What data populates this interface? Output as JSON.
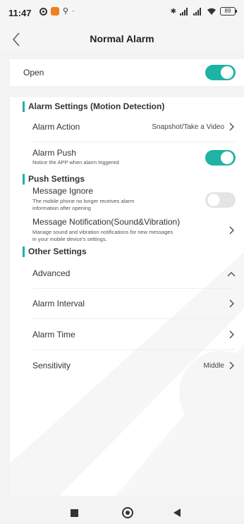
{
  "status_bar": {
    "time": "11:47",
    "battery": "89"
  },
  "header": {
    "title": "Normal Alarm",
    "back_icon": "chevron-left-icon"
  },
  "open": {
    "label": "Open",
    "enabled": true
  },
  "sections": {
    "alarm_settings": {
      "title": "Alarm Settings (Motion Detection)",
      "alarm_action": {
        "label": "Alarm Action",
        "value": "Snapshot/Take a Video"
      },
      "alarm_push": {
        "label": "Alarm Push",
        "description": "Notice the APP when alarm triggered",
        "enabled": true
      }
    },
    "push_settings": {
      "title": "Push Settings",
      "message_ignore": {
        "label": "Message Ignore",
        "description_line1": "The mobile phone no longer receives alarm",
        "description_line2": "information after opening",
        "enabled": false
      },
      "message_notification": {
        "label": "Message Notification(Sound&Vibration)",
        "description_line1": "Manage sound and vibration notifications for new messages",
        "description_line2": "in your mobile device's settings."
      }
    },
    "other_settings": {
      "title": "Other Settings",
      "advanced": {
        "label": "Advanced"
      },
      "alarm_interval": {
        "label": "Alarm Interval"
      },
      "alarm_time": {
        "label": "Alarm Time"
      },
      "sensitivity": {
        "label": "Sensitivity",
        "value": "Middle"
      }
    }
  },
  "colors": {
    "accent": "#1fb3a4",
    "toggle_off": "#e4e4e4",
    "background": "#f3f3f3"
  }
}
